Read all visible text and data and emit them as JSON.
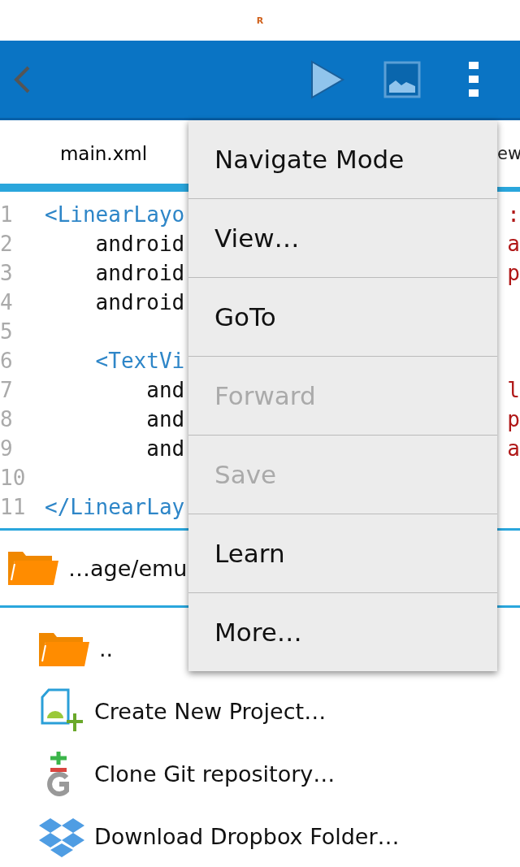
{
  "status_bar": {
    "indicator": "R"
  },
  "tabs": [
    {
      "label": "main.xml",
      "selected": true
    },
    {
      "label": "ew",
      "selected": false
    }
  ],
  "code_lines": [
    {
      "number": "1",
      "left": "<LinearLayo",
      "kind": "tag",
      "right": ":"
    },
    {
      "number": "2",
      "left": "    android",
      "kind": "attr",
      "right": "a"
    },
    {
      "number": "3",
      "left": "    android",
      "kind": "attr",
      "right": "p"
    },
    {
      "number": "4",
      "left": "    android",
      "kind": "attr"
    },
    {
      "number": "5"
    },
    {
      "number": "6",
      "left": "    <TextVi",
      "kind": "tag"
    },
    {
      "number": "7",
      "left": "        and",
      "kind": "attr",
      "right": "l"
    },
    {
      "number": "8",
      "left": "        and",
      "kind": "attr",
      "right": "p"
    },
    {
      "number": "9",
      "left": "        and",
      "kind": "attr",
      "right": "a"
    },
    {
      "number": "10"
    },
    {
      "number": "11",
      "left": "</LinearLay",
      "kind": "tag"
    }
  ],
  "path_bar": {
    "path": "…age/emu"
  },
  "files": [
    {
      "kind": "folder",
      "label": ".."
    },
    {
      "kind": "project",
      "label": "Create New Project…"
    },
    {
      "kind": "git",
      "label": "Clone Git repository…"
    },
    {
      "kind": "dropbox",
      "label": "Download Dropbox Folder…"
    }
  ],
  "menu": [
    {
      "label": "Navigate Mode",
      "disabled": false
    },
    {
      "label": "View…",
      "disabled": false
    },
    {
      "label": "GoTo",
      "disabled": false
    },
    {
      "label": "Forward",
      "disabled": true
    },
    {
      "label": "Save",
      "disabled": true
    },
    {
      "label": "Learn",
      "disabled": false
    },
    {
      "label": "More…",
      "disabled": false
    }
  ]
}
